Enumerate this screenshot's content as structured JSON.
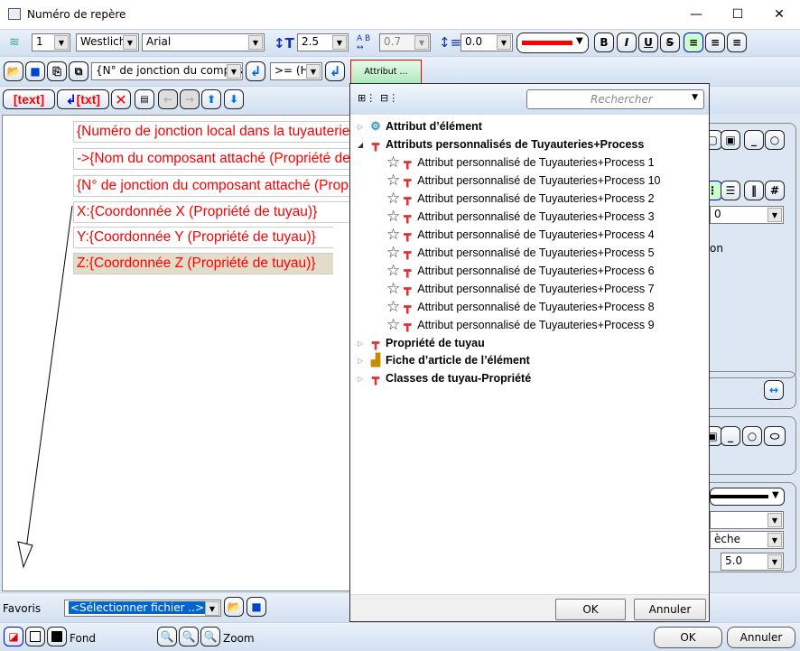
{
  "window": {
    "title": "Numéro de repère",
    "minimize": "—",
    "maximize": "☐",
    "close": "✕"
  },
  "toolbar1": {
    "layer": "1",
    "linetype": "Westlich",
    "font": "Arial",
    "height": "2.5",
    "width_ratio": "0.7",
    "spacing": "0.0",
    "color": "#ff0000",
    "bold": "B",
    "italic": "I",
    "underline": "U",
    "strike": "S"
  },
  "toolbar2": {
    "attribute_combo": "{N° de jonction du composant attaché",
    "operator_combo": ">= (HiC",
    "attribut_button": "Attribut ..."
  },
  "toolbar3": {
    "text_button": "text",
    "txt_button": "txt"
  },
  "editor": {
    "lines": [
      "{Numéro de jonction local dans la tuyauterie}",
      "->{Nom du composant attaché (Propriété de tuyau)}",
      "{N° de jonction du composant attaché (Propriété de tuyau)}",
      "X:{Coordonnée X (Propriété de tuyau)}",
      "Y:{Coordonnée Y (Propriété de tuyau)}",
      "Z:{Coordonnée Z (Propriété de tuyau)}"
    ]
  },
  "popup": {
    "search_placeholder": "Rechercher",
    "tree": [
      {
        "label": "Attribut d’élément",
        "bold": true,
        "level": 0,
        "expanded": false
      },
      {
        "label": "Attributs personnalisés de Tuyauteries+Process",
        "bold": true,
        "level": 0,
        "expanded": true
      },
      {
        "label": "Attribut personnalisé de Tuyauteries+Process 1",
        "level": 1
      },
      {
        "label": "Attribut personnalisé de Tuyauteries+Process 10",
        "level": 1
      },
      {
        "label": "Attribut personnalisé de Tuyauteries+Process 2",
        "level": 1
      },
      {
        "label": "Attribut personnalisé de Tuyauteries+Process 3",
        "level": 1
      },
      {
        "label": "Attribut personnalisé de Tuyauteries+Process 4",
        "level": 1
      },
      {
        "label": "Attribut personnalisé de Tuyauteries+Process 5",
        "level": 1
      },
      {
        "label": "Attribut personnalisé de Tuyauteries+Process 6",
        "level": 1
      },
      {
        "label": "Attribut personnalisé de Tuyauteries+Process 7",
        "level": 1
      },
      {
        "label": "Attribut personnalisé de Tuyauteries+Process 8",
        "level": 1
      },
      {
        "label": "Attribut personnalisé de Tuyauteries+Process 9",
        "level": 1
      },
      {
        "label": "Propriété de tuyau",
        "bold": true,
        "level": 0,
        "expanded": false
      },
      {
        "label": "Fiche d’article de l’élément",
        "bold": true,
        "level": 0,
        "expanded": false
      },
      {
        "label": "Classes de tuyau-Propriété",
        "bold": true,
        "level": 0,
        "expanded": false
      }
    ],
    "ok": "OK",
    "cancel": "Annuler"
  },
  "right_panel": {
    "combo1": "0",
    "label1": "on",
    "combo2": "",
    "combo3": "èche",
    "combo4": "5.0"
  },
  "footer": {
    "favoris_label": "Favoris",
    "favoris_combo": "<Sélectionner fichier ..>",
    "fond_label": "Fond",
    "zoom_label": "Zoom",
    "ok": "OK",
    "cancel": "Annuler"
  }
}
